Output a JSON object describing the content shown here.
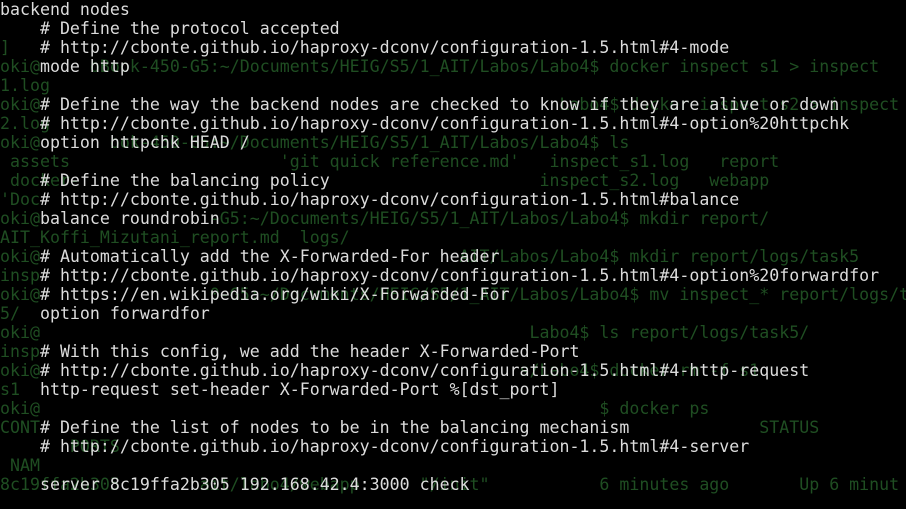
{
  "terminal": {
    "colors": {
      "background": "#000000",
      "foreground": "#dcdcdc",
      "ghost_text": "#1f4e22"
    },
    "background_lines": [
      "]",
      "oki@     oBook-450-G5:~/Documents/HEIG/S5/1_AIT/Labos/Labo4$ docker inspect s1 > inspect",
      "1.log",
      "oki@                                                    Labo4$ docker inspect s2 > inspect",
      "2.log",
      "oki@       ook-450-G5:~/Documents/HEIG/S5/1_AIT/Labos/Labo4$ ls",
      " assets                     'git quick reference.md'   inspect_s1.log   report",
      " docker-                                              inspect_s2.log   webapp",
      "'Doc",
      "oki@                 -G5:~/Documents/HEIG/S5/1_AIT/Labos/Labo4$ mkdir report/",
      "AIT_Koffi_Mizutani_report.md  logs/",
      "oki@                                          AIT/Labos/Labo4$ mkdir report/logs/task5",
      "insp",
      "oki@                 0-G5:~/Documents/HEIG/S5/1_AIT/Labos/Labo4$ mv inspect_* report/logs/t",
      "5/",
      "oki@                                                 Labo4$ ls report/logs/task5/",
      "insp",
      "oki@                                                s/Labo4$ docker rm -f s1",
      "s1",
      "oki@                                                        $ docker ps",
      "CONT                                                                        STATUS",
      "       PORTS",
      " NAM",
      "8c19ffa2b305        ait/labo4/webapp      \"/init\"           6 minutes ago       Up 6 minut"
    ],
    "config_lines": [
      "backend nodes",
      "    # Define the protocol accepted",
      "    # http://cbonte.github.io/haproxy-dconv/configuration-1.5.html#4-mode",
      "    mode http",
      "",
      "    # Define the way the backend nodes are checked to know if they are alive or down",
      "    # http://cbonte.github.io/haproxy-dconv/configuration-1.5.html#4-option%20httpchk",
      "    option httpchk HEAD /",
      "",
      "    # Define the balancing policy",
      "    # http://cbonte.github.io/haproxy-dconv/configuration-1.5.html#balance",
      "    balance roundrobin",
      "",
      "    # Automatically add the X-Forwarded-For header",
      "    # http://cbonte.github.io/haproxy-dconv/configuration-1.5.html#4-option%20forwardfor",
      "    # https://en.wikipedia.org/wiki/X-Forwarded-For",
      "    option forwardfor",
      "",
      "    # With this config, we add the header X-Forwarded-Port",
      "    # http://cbonte.github.io/haproxy-dconv/configuration-1.5.html#4-http-request",
      "    http-request set-header X-Forwarded-Port %[dst_port]",
      "",
      "    # Define the list of nodes to be in the balancing mechanism",
      "    # http://cbonte.github.io/haproxy-dconv/configuration-1.5.html#4-server",
      "",
      "    server 8c19ffa2b305 192.168.42.4:3000 check"
    ]
  }
}
